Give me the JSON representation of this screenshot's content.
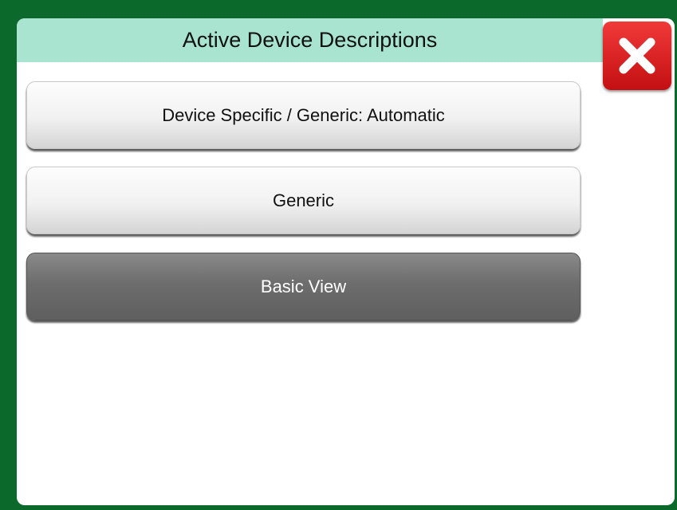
{
  "dialog": {
    "title": "Active Device Descriptions",
    "close_icon": "close-x-icon"
  },
  "options": [
    {
      "label": "Device Specific / Generic: Automatic",
      "selected": false
    },
    {
      "label": "Generic",
      "selected": false
    },
    {
      "label": "Basic View",
      "selected": true
    }
  ],
  "colors": {
    "frame": "#0b6a2b",
    "title_bar": "#a8e4d0",
    "close_button": "#e02225",
    "selected_button": "#6d6d6d"
  }
}
